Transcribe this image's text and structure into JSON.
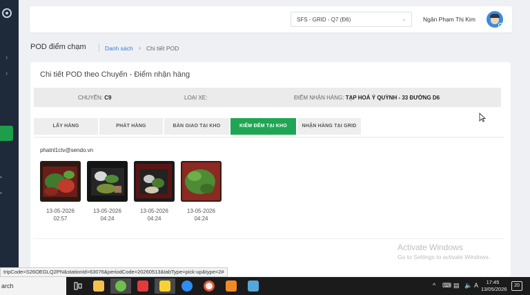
{
  "header": {
    "station_select": "SFS - GRID - Q7 (Đ6)",
    "user_name": "Ngân Phạm Thị Kim"
  },
  "breadcrumb": {
    "page_title": "POD điểm chạm",
    "link": "Danh sách",
    "current": "Chi tiết POD"
  },
  "card": {
    "title": "Chi tiết POD theo Chuyến - Điểm nhận hàng",
    "info": {
      "trip_label": "CHUYẾN:",
      "trip_value": "C9",
      "vehicle_label": "LOẠI XE:",
      "vehicle_value": "",
      "pickup_label": "ĐIỂM NHẬN HÀNG:",
      "pickup_value": "TẠP HOÁ Ý QUỲNH - 33 ĐƯỜNG D6"
    },
    "tabs": [
      {
        "label": "LẤY HÀNG",
        "active": false
      },
      {
        "label": "PHÁT HÀNG",
        "active": false
      },
      {
        "label": "BÀN GIAO TẠI KHO",
        "active": false
      },
      {
        "label": "KIỂM ĐẾM TẠI KHO",
        "active": true
      },
      {
        "label": "NHẬN HÀNG TẠI GRID",
        "active": false
      }
    ],
    "email": "phatnl1ctv@sendo.vn",
    "photos": [
      {
        "date": "13-05-2026",
        "time": "02:57"
      },
      {
        "date": "13-05-2026",
        "time": "04:24"
      },
      {
        "date": "13-05-2026",
        "time": "04:24"
      },
      {
        "date": "13-05-2026",
        "time": "04:24"
      }
    ]
  },
  "watermark": {
    "line1": "Activate Windows",
    "line2": "Go to Settings to activate Windows."
  },
  "status_url": "tripCode=S26OEGLQ2PN&stationId=63076&periodCode=20260513&tabType=pick-up&type=2#",
  "taskbar": {
    "search": "arch",
    "time": "17:45",
    "date": "13/05/2026",
    "notifications": "20"
  },
  "colors": {
    "accent_green": "#1fa655",
    "link_blue": "#3a7bd5",
    "sidebar": "#1e2a3a"
  }
}
